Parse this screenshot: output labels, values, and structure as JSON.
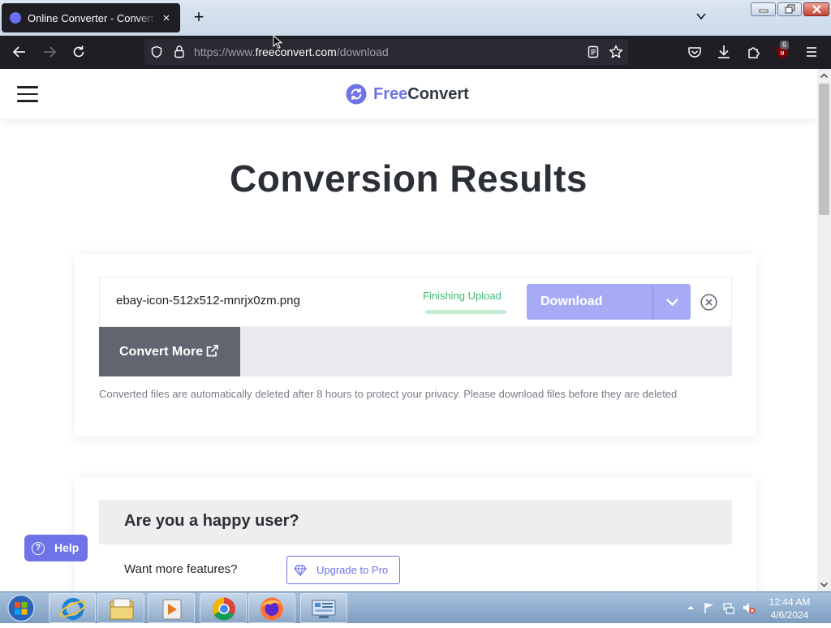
{
  "browser": {
    "tab_title": "Online Converter - Convert Ima",
    "tab_close_label": "×",
    "new_tab_label": "+",
    "url_prefix": "https://www.",
    "url_domain": "freeconvert.com",
    "url_path": "/download",
    "extension_badge": "6"
  },
  "header": {
    "logo_part1": "Free",
    "logo_part2": "Convert"
  },
  "main": {
    "title": "Conversion Results",
    "file": {
      "name": "ebay-icon-512x512-mnrjx0zm.png",
      "status": "Finishing Upload",
      "progress": 1.0,
      "download_label": "Download"
    },
    "convert_more_label": "Convert More",
    "privacy_note": "Converted files are automatically deleted after 8 hours to protect your privacy. Please download files before they are deleted"
  },
  "feedback": {
    "title": "Are you a happy user?",
    "features_prompt": "Want more features?",
    "upgrade_label": "Upgrade to Pro"
  },
  "help": {
    "label": "Help",
    "icon_glyph": "?"
  },
  "taskbar": {
    "time": "12:44 AM",
    "date": "4/6/2024"
  },
  "colors": {
    "brand": "#6e73e8",
    "download_button": "#a7aaf5",
    "status_green": "#3fbd75",
    "convert_more": "#60656f"
  }
}
